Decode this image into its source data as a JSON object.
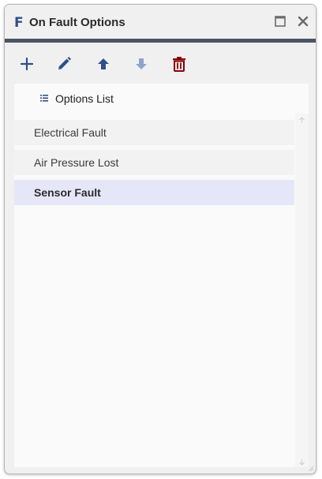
{
  "window": {
    "logo": "F",
    "title": "On Fault Options"
  },
  "toolbar": {
    "buttons": [
      {
        "name": "add-icon",
        "color": "#2f4f8a"
      },
      {
        "name": "edit-pencil-icon",
        "color": "#2f4f8a"
      },
      {
        "name": "arrow-up-icon",
        "color": "#2f4f8a"
      },
      {
        "name": "arrow-down-icon",
        "color": "#8ea3cc",
        "disabled": true
      },
      {
        "name": "trash-icon",
        "color": "#8b0000"
      }
    ]
  },
  "list": {
    "title": "Options List",
    "items": [
      {
        "label": "Electrical Fault",
        "selected": false
      },
      {
        "label": "Air Pressure Lost",
        "selected": false
      },
      {
        "label": "Sensor Fault",
        "selected": true
      }
    ]
  },
  "colors": {
    "accent_bar": "#4b5563",
    "selection": "#e5e7f9",
    "icon_blue": "#2f4f8a",
    "delete_red": "#8b0000"
  }
}
